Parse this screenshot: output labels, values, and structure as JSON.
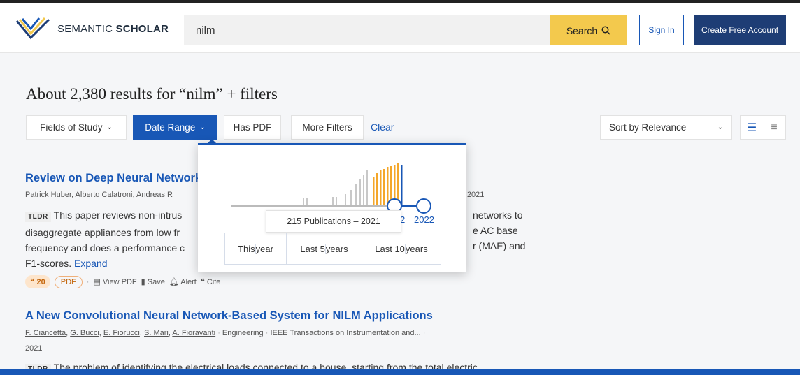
{
  "header": {
    "logo_prefix": "SEMANTIC ",
    "logo_bold": "SCHOLAR",
    "search_value": "nilm",
    "search_button": "Search",
    "sign_in": "Sign In",
    "create_account": "Create Free Account"
  },
  "results": {
    "title": "About 2,380 results for “nilm” + filters"
  },
  "filters": {
    "fields_of_study": "Fields of Study",
    "date_range": "Date Range",
    "has_pdf": "Has PDF",
    "more_filters": "More Filters",
    "clear": "Clear",
    "sort": "Sort by Relevance"
  },
  "date_popup": {
    "tooltip": "215 Publications – 2021",
    "year_partial": "2",
    "year_end": "2022",
    "quick_options": [
      {
        "line1": "This",
        "line2": "year"
      },
      {
        "line1": "Last 5",
        "line2": "years"
      },
      {
        "line1": "Last 10",
        "line2": "years"
      }
    ]
  },
  "papers": [
    {
      "title": "Review on Deep Neural Network",
      "authors": [
        {
          "label": "Patrick Huber"
        },
        {
          "label": "Alberto Calatroni"
        },
        {
          "label": "Andreas R"
        }
      ],
      "date_partial": "il 2021",
      "tldr_tag": "TLDR",
      "tldr_lines": [
        "This paper reviews non-intrus",
        "disaggregate appliances from low fr",
        "frequency and does a performance c",
        "F1-scores."
      ],
      "tldr_right": [
        "networks to",
        "e AC base",
        "r (MAE) and"
      ],
      "expand": "Expand",
      "citations": "20",
      "pdf": "PDF",
      "actions": [
        "View PDF",
        "Save",
        "Alert",
        "Cite"
      ]
    },
    {
      "title": "A New Convolutional Neural Network-Based System for NILM Applications",
      "authors": [
        {
          "label": "F. Ciancetta"
        },
        {
          "label": "G. Bucci"
        },
        {
          "label": "E. Fiorucci"
        },
        {
          "label": "S. Mari"
        },
        {
          "label": "A. Fioravanti"
        }
      ],
      "field": "Engineering",
      "venue": "IEEE Transactions on Instrumentation and...",
      "year": "2021",
      "tldr_tag": "TLDR",
      "tldr_partial": "The problem of identifying the electrical loads connected to a house, starting from the total electric"
    }
  ],
  "colors": {
    "brand_blue": "#1857b6",
    "navy": "#1e3d75",
    "search_yellow": "#f3c94d",
    "bar_orange": "#f4a72a",
    "bar_grey": "#c8c8c8"
  }
}
